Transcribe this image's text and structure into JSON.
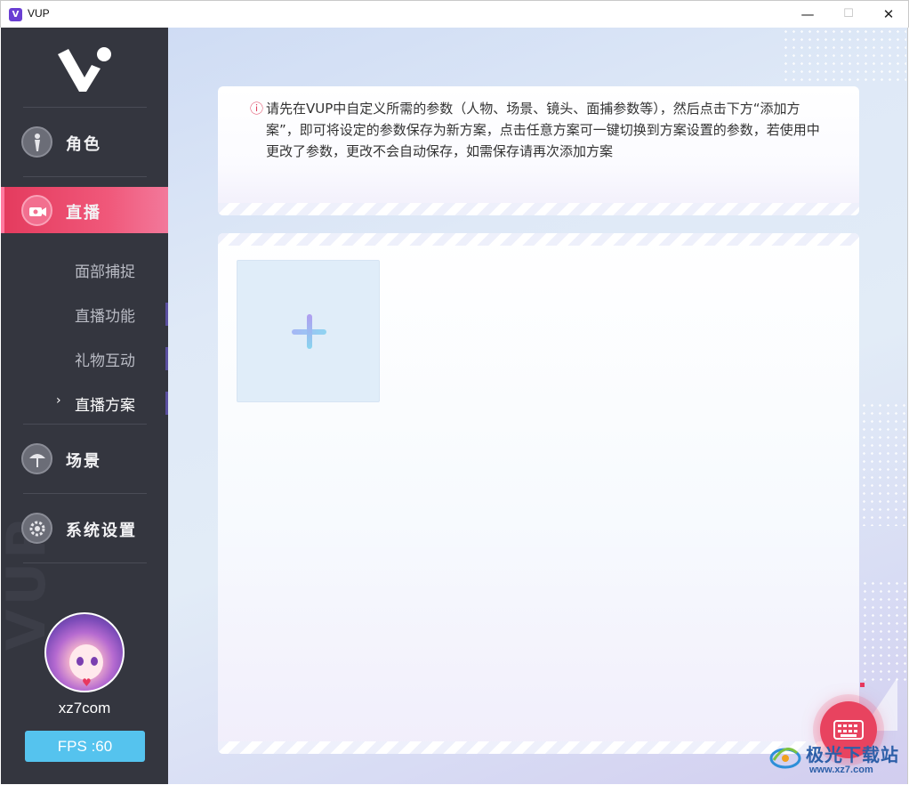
{
  "window": {
    "title": "VUP",
    "icon_letter": "V",
    "minimize_glyph": "—",
    "maximize_glyph": "☐",
    "close_glyph": "✕"
  },
  "sidebar": {
    "nav": [
      {
        "label": "角色",
        "icon": "character-icon"
      },
      {
        "label": "直播",
        "icon": "live-camera-icon",
        "active": true
      },
      {
        "label": "场景",
        "icon": "umbrella-scene-icon"
      },
      {
        "label": "系统设置",
        "icon": "gear-icon"
      }
    ],
    "sub_items": [
      {
        "label": "面部捕捉"
      },
      {
        "label": "直播功能"
      },
      {
        "label": "礼物互动"
      },
      {
        "label": "直播方案",
        "current": true
      }
    ],
    "current_arrow": "›",
    "watermark_text": "VUP",
    "user": {
      "name": "xz7com"
    },
    "fps_label": "FPS :60"
  },
  "main": {
    "notice": {
      "icon": "ⓘ",
      "text": "请先在VUP中自定义所需的参数（人物、场景、镜头、面捕参数等），然后点击下方“添加方案”，即可将设定的参数保存为新方案，点击任意方案可一键切换到方案设置的参数，若使用中更改了参数，更改不会自动保存，如需保存请再次添加方案"
    },
    "add_plan_icon": "plus-icon"
  },
  "watermark": {
    "title": "极光下载站",
    "url": "www.xz7.com"
  },
  "colors": {
    "sidebar_bg": "#34363f",
    "accent_pink": "#e8435f",
    "fps_blue": "#55c3ee",
    "watermark_blue": "#2d5fa8"
  }
}
